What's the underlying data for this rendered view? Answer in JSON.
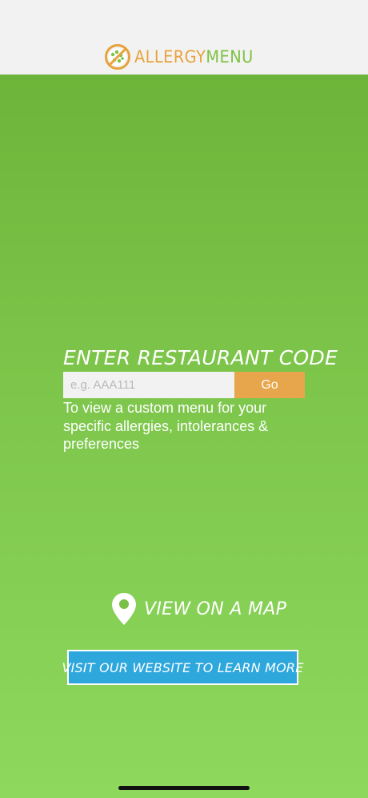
{
  "header": {
    "logo_text_part1": "ALLERGY",
    "logo_text_part2": "MENU",
    "logo_icon": "allergy-menu-logo-icon"
  },
  "restaurant_code": {
    "title": "ENTER RESTAURANT CODE",
    "input_value": "",
    "input_placeholder": "e.g. AAA111",
    "go_label": "Go",
    "description": "To view a custom menu for your specific allergies, intolerances & preferences"
  },
  "map": {
    "label": "VIEW ON A MAP",
    "icon": "map-pin-icon"
  },
  "website": {
    "label": "VISIT OUR WEBSITE TO LEARN MORE"
  },
  "colors": {
    "header_bg": "#f2f2f2",
    "logo_orange": "#e8a23b",
    "logo_green": "#7dc242",
    "main_green_top": "#6db53a",
    "main_green_bottom": "#8ed85e",
    "go_button": "#e7a64b",
    "website_button": "#2ea7dd"
  }
}
